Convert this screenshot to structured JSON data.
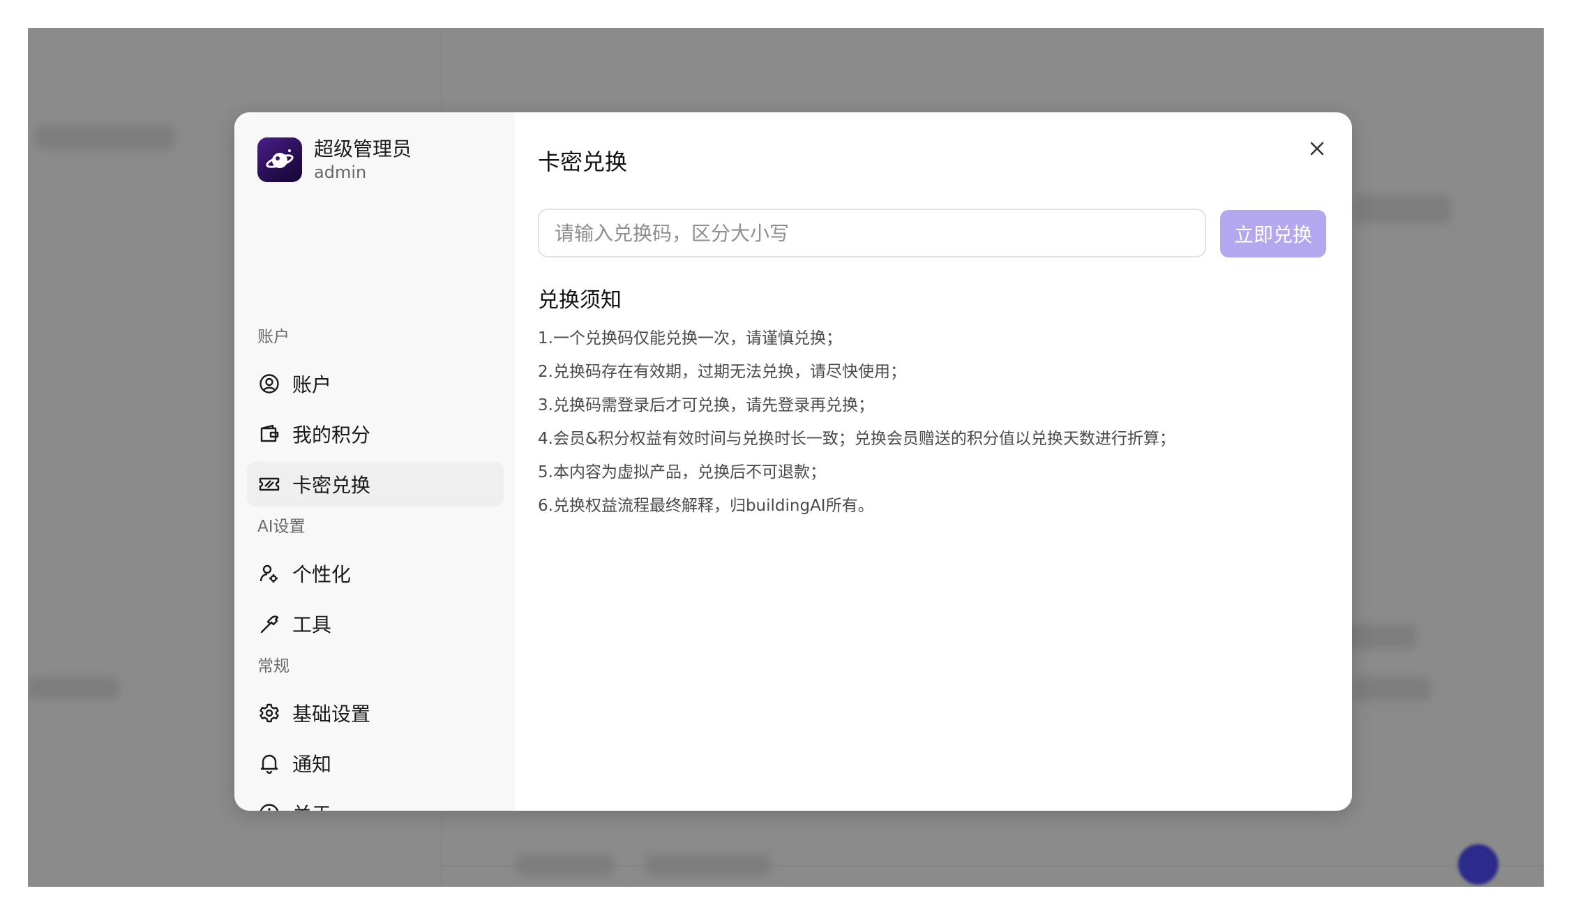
{
  "user": {
    "name": "超级管理员",
    "id": "admin"
  },
  "sidebar": {
    "sections": [
      {
        "label": "账户",
        "items": [
          {
            "label": "账户",
            "icon": "user-circle-icon"
          },
          {
            "label": "我的积分",
            "icon": "wallet-icon"
          },
          {
            "label": "卡密兑换",
            "icon": "ticket-icon",
            "active": true
          }
        ]
      },
      {
        "label": "AI设置",
        "items": [
          {
            "label": "个性化",
            "icon": "user-cog-icon"
          },
          {
            "label": "工具",
            "icon": "hammer-icon"
          }
        ]
      },
      {
        "label": "常规",
        "items": [
          {
            "label": "基础设置",
            "icon": "gear-icon"
          },
          {
            "label": "通知",
            "icon": "bell-icon"
          },
          {
            "label": "关于",
            "icon": "info-icon"
          }
        ]
      }
    ]
  },
  "main": {
    "title": "卡密兑换",
    "input_placeholder": "请输入兑换码，区分大小写",
    "input_value": "",
    "button_label": "立即兑换",
    "notice_title": "兑换须知",
    "notices": [
      "1.一个兑换码仅能兑换一次，请谨慎兑换；",
      "2.兑换码存在有效期，过期无法兑换，请尽快使用；",
      "3.兑换码需登录后才可兑换，请先登录再兑换；",
      "4.会员&积分权益有效时间与兑换时长一致；兑换会员赠送的积分值以兑换天数进行折算；",
      "5.本内容为虚拟产品，兑换后不可退款；",
      "6.兑换权益流程最终解释，归buildingAI所有。"
    ]
  },
  "colors": {
    "accent_button": "#b3a8f0",
    "overlay": "#8b8b8b",
    "avatar": "#3a1670"
  }
}
